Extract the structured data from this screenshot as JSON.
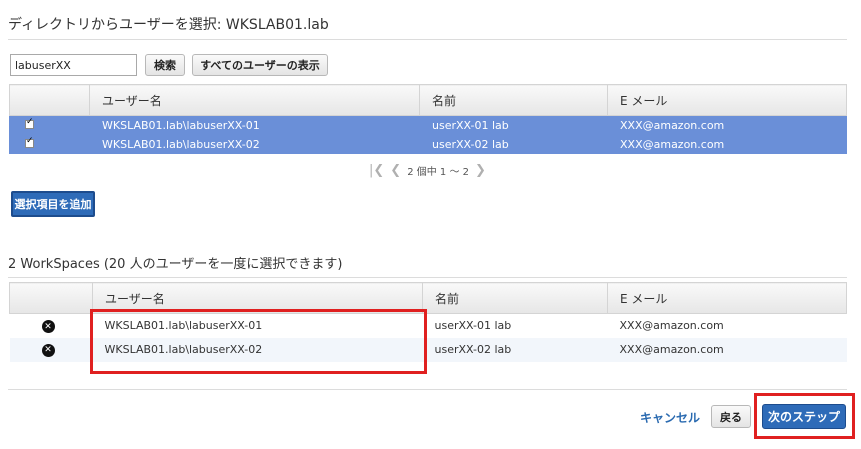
{
  "directory_section": {
    "title": "ディレクトリからユーザーを選択: WKSLAB01.lab"
  },
  "search": {
    "value": "labuserXX",
    "search_button": "検索",
    "show_all_button": "すべてのユーザーの表示"
  },
  "top_table": {
    "headers": [
      "",
      "ユーザー名",
      "名前",
      "E メール"
    ],
    "rows": [
      {
        "username": "WKSLAB01.lab\\labuserXX-01",
        "name": "userXX-01 lab",
        "email": "XXX@amazon.com"
      },
      {
        "username": "WKSLAB01.lab\\labuserXX-02",
        "name": "userXX-02 lab",
        "email": "XXX@amazon.com"
      }
    ]
  },
  "pagination": {
    "text": "2 個中 1 ～ 2"
  },
  "add_selected_button": "選択項目を追加",
  "workspaces_section": {
    "title": "2 WorkSpaces (20 人のユーザーを一度に選択できます)"
  },
  "bottom_table": {
    "headers": [
      "",
      "ユーザー名",
      "名前",
      "E メール"
    ],
    "rows": [
      {
        "username": "WKSLAB01.lab\\labuserXX-01",
        "name": "userXX-01 lab",
        "email": "XXX@amazon.com"
      },
      {
        "username": "WKSLAB01.lab\\labuserXX-02",
        "name": "userXX-02 lab",
        "email": "XXX@amazon.com"
      }
    ]
  },
  "footer": {
    "cancel": "キャンセル",
    "back": "戻る",
    "next": "次のステップ"
  },
  "colors": {
    "selected_row": "#6a8fd8",
    "primary_button": "#2e6bb8",
    "highlight": "#e02020"
  }
}
